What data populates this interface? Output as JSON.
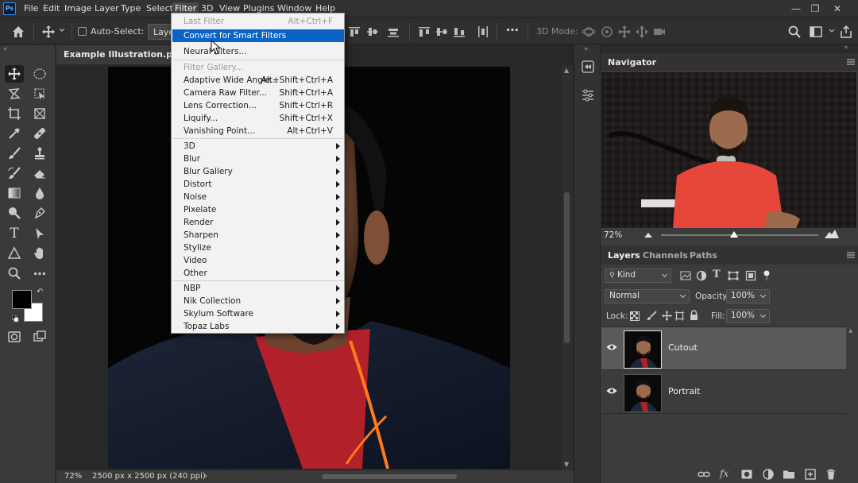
{
  "app": {
    "logo": "Ps",
    "menus": [
      "File",
      "Edit",
      "Image",
      "Layer",
      "Type",
      "Select",
      "Filter",
      "3D",
      "View",
      "Plugins",
      "Window",
      "Help"
    ],
    "active_menu": "Filter"
  },
  "options_bar": {
    "auto_select_label": "Auto-Select:",
    "auto_select_value": "Laye",
    "mode_3d_label": "3D Mode:"
  },
  "document": {
    "tab_title": "Example Illustration.psd @",
    "zoom": "72%",
    "doc_info": "2500 px x 2500 px (240 ppi)"
  },
  "filter_menu": {
    "items": [
      {
        "label": "Last Filter",
        "shortcut": "Alt+Ctrl+F",
        "state": "disabled"
      },
      {
        "label": "Convert for Smart Filters",
        "shortcut": "",
        "state": "highlighted"
      },
      {
        "label": "Neural Filters...",
        "shortcut": "",
        "state": "normal"
      },
      {
        "label": "Filter Gallery...",
        "shortcut": "",
        "state": "disabled"
      },
      {
        "label": "Adaptive Wide Angle...",
        "shortcut": "Alt+Shift+Ctrl+A",
        "state": "normal"
      },
      {
        "label": "Camera Raw Filter...",
        "shortcut": "Shift+Ctrl+A",
        "state": "normal"
      },
      {
        "label": "Lens Correction...",
        "shortcut": "Shift+Ctrl+R",
        "state": "normal"
      },
      {
        "label": "Liquify...",
        "shortcut": "Shift+Ctrl+X",
        "state": "normal"
      },
      {
        "label": "Vanishing Point...",
        "shortcut": "Alt+Ctrl+V",
        "state": "normal"
      },
      {
        "label": "3D",
        "submenu": true
      },
      {
        "label": "Blur",
        "submenu": true
      },
      {
        "label": "Blur Gallery",
        "submenu": true
      },
      {
        "label": "Distort",
        "submenu": true
      },
      {
        "label": "Noise",
        "submenu": true
      },
      {
        "label": "Pixelate",
        "submenu": true
      },
      {
        "label": "Render",
        "submenu": true
      },
      {
        "label": "Sharpen",
        "submenu": true
      },
      {
        "label": "Stylize",
        "submenu": true
      },
      {
        "label": "Video",
        "submenu": true
      },
      {
        "label": "Other",
        "submenu": true
      },
      {
        "label": "NBP",
        "submenu": true
      },
      {
        "label": "Nik Collection",
        "submenu": true
      },
      {
        "label": "Skylum Software",
        "submenu": true
      },
      {
        "label": "Topaz Labs",
        "submenu": true
      }
    ]
  },
  "navigator": {
    "title": "Navigator",
    "zoom": "72%"
  },
  "layers_panel": {
    "tabs": [
      "Layers",
      "Channels",
      "Paths"
    ],
    "active_tab": "Layers",
    "filter_kind": "Kind",
    "blend_mode": "Normal",
    "opacity_label": "Opacity:",
    "opacity_value": "100%",
    "lock_label": "Lock:",
    "fill_label": "Fill:",
    "fill_value": "100%",
    "layers": [
      {
        "name": "Cutout",
        "visible": true,
        "selected": true
      },
      {
        "name": "Portrait",
        "visible": true,
        "selected": false
      }
    ]
  },
  "colors": {
    "menu_highlight": "#0a64c8",
    "foreground_swatch": "#000000",
    "background_swatch": "#ffffff"
  }
}
